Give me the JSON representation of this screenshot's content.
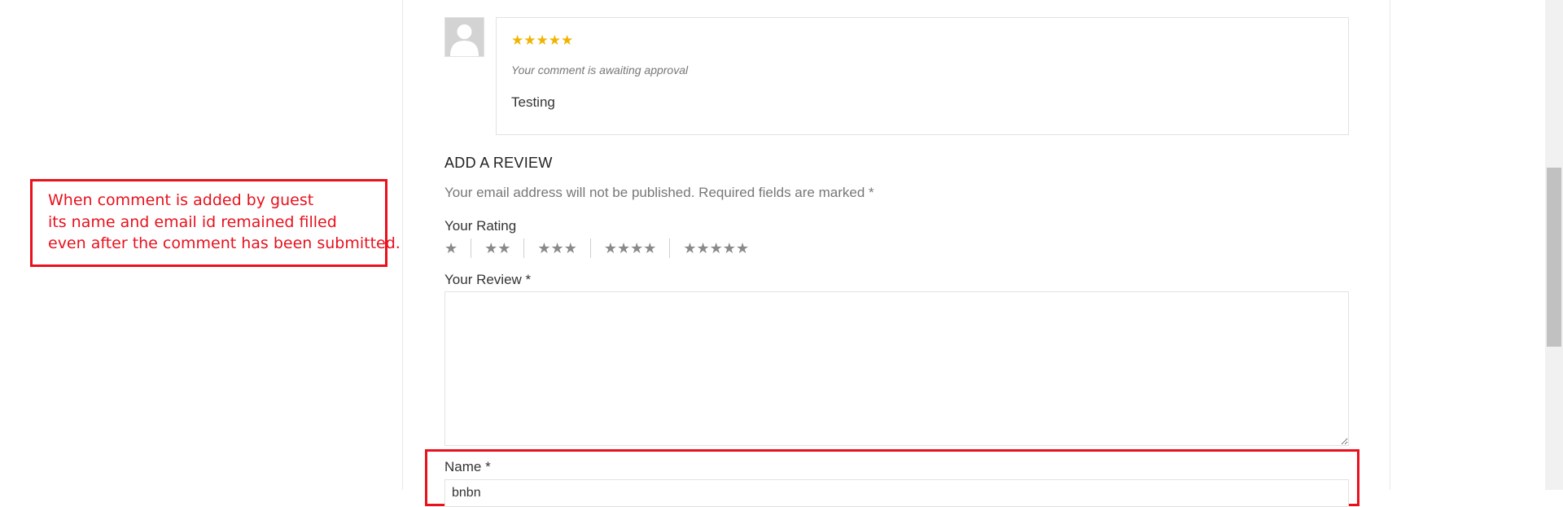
{
  "annotation": {
    "lines": [
      "When comment is added by guest",
      "its name and email id remained filled",
      "even after the comment has been submitted."
    ]
  },
  "comment": {
    "stars": "★★★★★",
    "status": "Your comment is awaiting approval",
    "text": "Testing"
  },
  "review_form": {
    "title": "ADD A REVIEW",
    "notes": "Your email address will not be published. Required fields are marked *",
    "rating_label": "Your Rating",
    "rating_options": [
      "★",
      "★★",
      "★★★",
      "★★★★",
      "★★★★★"
    ],
    "review_label": "Your Review *",
    "review_value": "",
    "name_label": "Name *",
    "name_value": "bnbn"
  },
  "colors": {
    "highlight": "#e8111d",
    "star_filled": "#f0b400",
    "star_empty": "#8a8a8a"
  }
}
